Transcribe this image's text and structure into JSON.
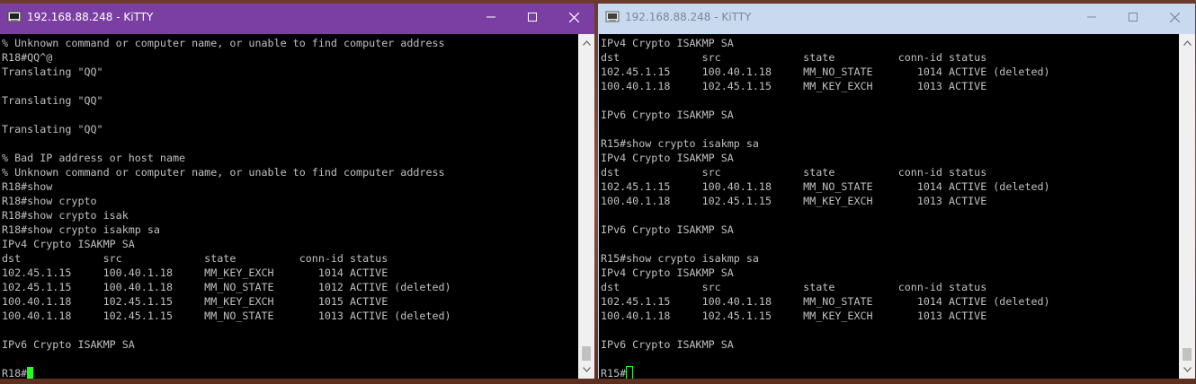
{
  "windows": {
    "left": {
      "title": "192.168.88.248 - KiTTY",
      "titlebar_color": "#7b3fa3",
      "focused": true,
      "icon": "kitty-terminal-icon",
      "controls": [
        "minimize-icon",
        "maximize-icon",
        "close-icon"
      ],
      "lines": [
        "% Unknown command or computer name, or unable to find computer address",
        "R18#QQ^@",
        "Translating \"QQ\"",
        "",
        "Translating \"QQ\"",
        "",
        "Translating \"QQ\"",
        "",
        "% Bad IP address or host name",
        "% Unknown command or computer name, or unable to find computer address",
        "R18#show",
        "R18#show crypto",
        "R18#show crypto isak",
        "R18#show crypto isakmp sa",
        "IPv4 Crypto ISAKMP SA",
        "dst             src             state          conn-id status",
        "102.45.1.15     100.40.1.18     MM_KEY_EXCH       1014 ACTIVE",
        "102.45.1.15     100.40.1.18     MM_NO_STATE       1012 ACTIVE (deleted)",
        "100.40.1.18     102.45.1.15     MM_KEY_EXCH       1015 ACTIVE",
        "100.40.1.18     102.45.1.15     MM_NO_STATE       1013 ACTIVE (deleted)",
        "",
        "IPv6 Crypto ISAKMP SA",
        ""
      ],
      "prompt": "R18#"
    },
    "right": {
      "title": "192.168.88.248 - KiTTY",
      "titlebar_color": "#c9daf0",
      "focused": false,
      "icon": "kitty-terminal-icon",
      "controls": [
        "minimize-icon",
        "maximize-icon",
        "close-icon"
      ],
      "lines": [
        "IPv4 Crypto ISAKMP SA",
        "dst             src             state          conn-id status",
        "102.45.1.15     100.40.1.18     MM_NO_STATE       1014 ACTIVE (deleted)",
        "100.40.1.18     102.45.1.15     MM_KEY_EXCH       1013 ACTIVE",
        "",
        "IPv6 Crypto ISAKMP SA",
        "",
        "R15#show crypto isakmp sa",
        "IPv4 Crypto ISAKMP SA",
        "dst             src             state          conn-id status",
        "102.45.1.15     100.40.1.18     MM_NO_STATE       1014 ACTIVE (deleted)",
        "100.40.1.18     102.45.1.15     MM_KEY_EXCH       1013 ACTIVE",
        "",
        "IPv6 Crypto ISAKMP SA",
        "",
        "R15#show crypto isakmp sa",
        "IPv4 Crypto ISAKMP SA",
        "dst             src             state          conn-id status",
        "102.45.1.15     100.40.1.18     MM_NO_STATE       1014 ACTIVE (deleted)",
        "100.40.1.18     102.45.1.15     MM_KEY_EXCH       1013 ACTIVE",
        "",
        "IPv6 Crypto ISAKMP SA",
        ""
      ],
      "prompt": "R15#"
    }
  },
  "colors": {
    "terminal_bg": "#000000",
    "terminal_fg": "#c0c0c0",
    "cursor": "#22ff22"
  }
}
